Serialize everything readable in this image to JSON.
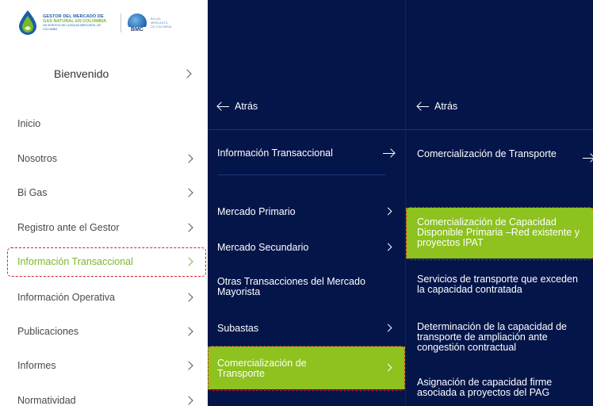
{
  "brand": {
    "gestor_line1": "GESTOR DEL MERCADO DE",
    "gestor_line2": "GAS NATURAL EN COLOMBIA",
    "gestor_line3": "UN SERVICIO DE LA BOLSA MERCANTIL DE COLOMBIA",
    "bmc_label": "BMC",
    "bmc_line1": "BOLSA",
    "bmc_line2": "MERCANTIL",
    "bmc_line3": "DE COLOMBIA"
  },
  "col1": {
    "welcome": "Bienvenido",
    "items": [
      {
        "label": "Inicio"
      },
      {
        "label": "Nosotros"
      },
      {
        "label": "Bi Gas"
      },
      {
        "label": "Registro ante el Gestor"
      },
      {
        "label": "Información Transaccional"
      },
      {
        "label": "Información Operativa"
      },
      {
        "label": "Publicaciones"
      },
      {
        "label": "Informes"
      },
      {
        "label": "Normatividad"
      }
    ]
  },
  "col2": {
    "back": "Atrás",
    "heading": "Información Transaccional",
    "items": [
      {
        "label": "Mercado Primario"
      },
      {
        "label": "Mercado Secundario"
      },
      {
        "label": "Otras Transacciones del Mercado Mayorista"
      },
      {
        "label": "Subastas"
      },
      {
        "label": "Comercialización de Transporte"
      }
    ]
  },
  "col3": {
    "back": "Atrás",
    "heading": "Comercialización de Transporte",
    "items": [
      {
        "label": "Comercialización de Capacidad Disponible Primaria –Red existente y proyectos IPAT"
      },
      {
        "label": "Servicios de transporte que exceden la capacidad contratada"
      },
      {
        "label": "Determinación de la capacidad de transporte de ampliación ante congestión contractual"
      },
      {
        "label": "Asignación de capacidad firme asociada a proyectos del PAG"
      }
    ]
  },
  "colors": {
    "navy": "#04154a",
    "accent_green": "#8dc21f",
    "highlight_text_green": "#7ab928",
    "annotation_red": "#d21f2b"
  }
}
